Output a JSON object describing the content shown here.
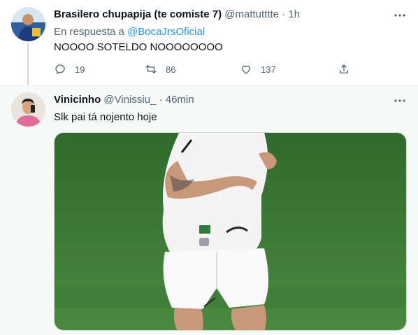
{
  "tweet1": {
    "display_name": "Brasilero chupapija (te comiste 7)",
    "handle": "@mattutttte",
    "separator": "·",
    "time": "1h",
    "reply_prefix": "En respuesta a",
    "reply_to": "@BocaJrsOficial",
    "text": "NOOOO SOTELDO NOOOOOOOO",
    "more_icon": "more-icon",
    "actions": {
      "reply_count": "19",
      "retweet_count": "86",
      "like_count": "137"
    }
  },
  "tweet2": {
    "display_name": "Vinicinho",
    "handle": "@Vinissiu_",
    "separator": "·",
    "time": "46min",
    "text": "Slk pai tá nojento hoje",
    "more_icon": "more-icon"
  },
  "colors": {
    "text": "#0f1419",
    "secondary": "#536471",
    "link": "#1d9bf0",
    "pitch": "#3f7a36",
    "kit": "#f4f4f4"
  }
}
